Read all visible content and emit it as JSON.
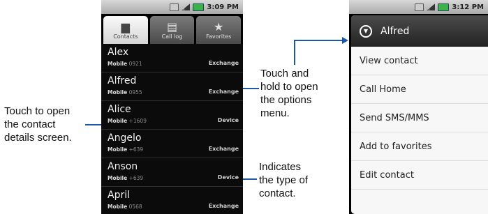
{
  "callouts": {
    "contact_details": "Touch to open\nthe contact\ndetails screen.",
    "options_menu": "Touch and\nhold to open\nthe options\nmenu.",
    "contact_type": "Indicates\nthe type of\ncontact."
  },
  "phone1": {
    "status_time": "3:09 PM",
    "tabs": [
      {
        "label": "Contacts",
        "icon": "contacts-icon",
        "active": true
      },
      {
        "label": "Call log",
        "icon": "call-log-icon",
        "active": false
      },
      {
        "label": "Favorites",
        "icon": "star-icon",
        "active": false
      }
    ],
    "contacts": [
      {
        "name": "Alex",
        "phone_label": "Mobile",
        "phone": "0921",
        "type": "Exchange"
      },
      {
        "name": "Alfred",
        "phone_label": "Mobile",
        "phone": "0955",
        "type": "Exchange"
      },
      {
        "name": "Alice",
        "phone_label": "Mobile",
        "phone": "+1609",
        "type": "Device"
      },
      {
        "name": "Angelo",
        "phone_label": "Mobile",
        "phone": "+639",
        "type": "Exchange"
      },
      {
        "name": "Anson",
        "phone_label": "Mobile",
        "phone": "+639",
        "type": "Device"
      },
      {
        "name": "April",
        "phone_label": "Mobile",
        "phone": "0568",
        "type": "Exchange"
      }
    ]
  },
  "phone2": {
    "status_time": "3:12 PM",
    "menu_title": "Alfred",
    "menu_items": [
      "View contact",
      "Call Home",
      "Send SMS/MMS",
      "Add to favorites",
      "Edit contact"
    ]
  },
  "colors": {
    "accent": "#1b58a8",
    "battery": "#3ab34a"
  }
}
